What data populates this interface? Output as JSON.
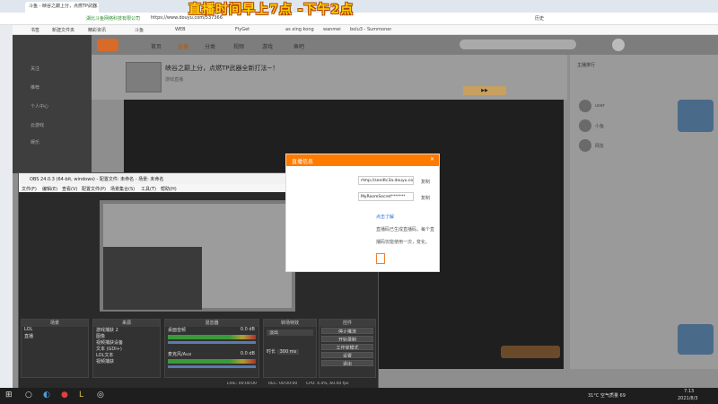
{
  "banner": "直播时间早上7点 -下午2点",
  "browser": {
    "tab_title": "斗鱼 - 映谷之巅上分，点燃TP武器...",
    "url_prefix": "湖北斗鱼网络科技有限公司",
    "url": "https://www.douyu.com/537366",
    "user_label": "历史",
    "bookmarks": [
      "书签",
      "新建文件夹",
      "精彩资讯",
      "斗鱼",
      "WEB",
      "FlyGet",
      "as xing kong",
      "wanmei",
      "bolu3 - Summoner"
    ]
  },
  "douyu": {
    "nav": [
      "首页",
      "直播",
      "分类",
      "视频",
      "游戏",
      "鱼吧"
    ],
    "side": [
      "关注",
      "推荐",
      "个人中心",
      "云游戏",
      "娱乐"
    ],
    "room_title": "峡谷之巅上分，点燃TP武器全新打法~！",
    "sub_tag": "游戏直播",
    "right_btn": "主播排行",
    "chat_names": [
      "user",
      "小鱼",
      "网友"
    ]
  },
  "dialog": {
    "title": "直播信息",
    "fields": [
      {
        "label": "",
        "value": "rtmp://sendtc3a.douyu.com/live",
        "action": "复制"
      },
      {
        "label": "",
        "value": "MyRoomSecret*******",
        "action": "复制"
      }
    ],
    "link": "点击了解",
    "note1": "直播码已生成直播码，每个直",
    "note2": "播码仅能使用一次，变化。"
  },
  "obs": {
    "title": "OBS 24.0.3 (64-bit, windows) - 配置文件: 未命名 - 场景: 未命名",
    "menu": [
      "文件(F)",
      "编辑(E)",
      "查看(V)",
      "配置文件(P)",
      "场景集合(S)",
      "工具(T)",
      "帮助(H)"
    ],
    "docks": {
      "scenes": {
        "title": "场景",
        "items": [
          "LOL",
          "直播"
        ]
      },
      "sources": {
        "title": "来源",
        "items": [
          "游戏捕获 2",
          "图像",
          "视频捕获设备",
          "文本 (GDI+)",
          "LOL文本",
          "视频捕获"
        ]
      },
      "mixer": {
        "title": "混音器",
        "channels": [
          {
            "name": "桌面音频",
            "level": "0.0 dB"
          },
          {
            "name": "麦克风/Aux",
            "level": "0.0 dB"
          }
        ]
      },
      "transitions": {
        "title": "转场特效",
        "type": "淡出",
        "duration_label": "时长",
        "duration": "300 ms"
      },
      "controls": {
        "title": "控件",
        "buttons": [
          "停止推流",
          "开始录制",
          "工作室模式",
          "设置",
          "退出"
        ]
      }
    },
    "status": {
      "live": "LIVE: 00:00:00",
      "rec": "REC: 00:00:00",
      "cpu": "CPU: 4.4%, 60.00 fps"
    }
  },
  "taskbar": {
    "weather": "31°C 空气质量 69",
    "time": "7:13",
    "date": "2021/8/3"
  }
}
